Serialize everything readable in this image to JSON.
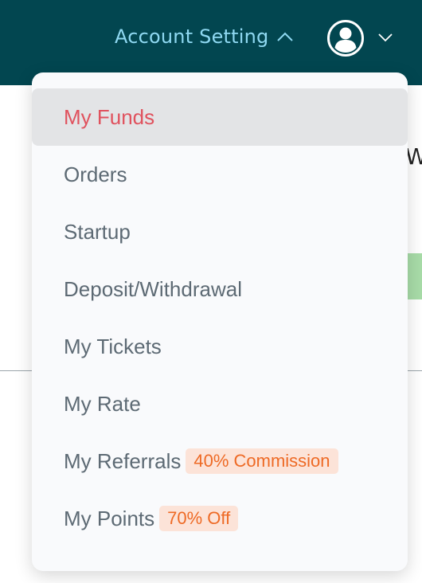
{
  "header": {
    "account_setting_label": "Account Setting",
    "account_chevron_icon": "chevron-up-icon",
    "avatar_icon": "user-avatar-icon",
    "avatar_chevron_icon": "chevron-down-icon",
    "background_color": "#024650",
    "label_color": "#8fd9f2"
  },
  "background_page": {
    "partial_text": "W"
  },
  "dropdown": {
    "items": [
      {
        "label": "My Funds",
        "active": true
      },
      {
        "label": "Orders"
      },
      {
        "label": "Startup"
      },
      {
        "label": "Deposit/Withdrawal"
      },
      {
        "label": "My Tickets"
      },
      {
        "label": "My Rate"
      },
      {
        "label": "My Referrals",
        "badge": "40% Commission"
      },
      {
        "label": "My Points",
        "badge": "70% Off"
      }
    ],
    "active_color": "#e0525e",
    "text_color": "#5d6a74",
    "badge_text_color": "#ee6a25",
    "badge_bg_color": "#fce3d8"
  }
}
